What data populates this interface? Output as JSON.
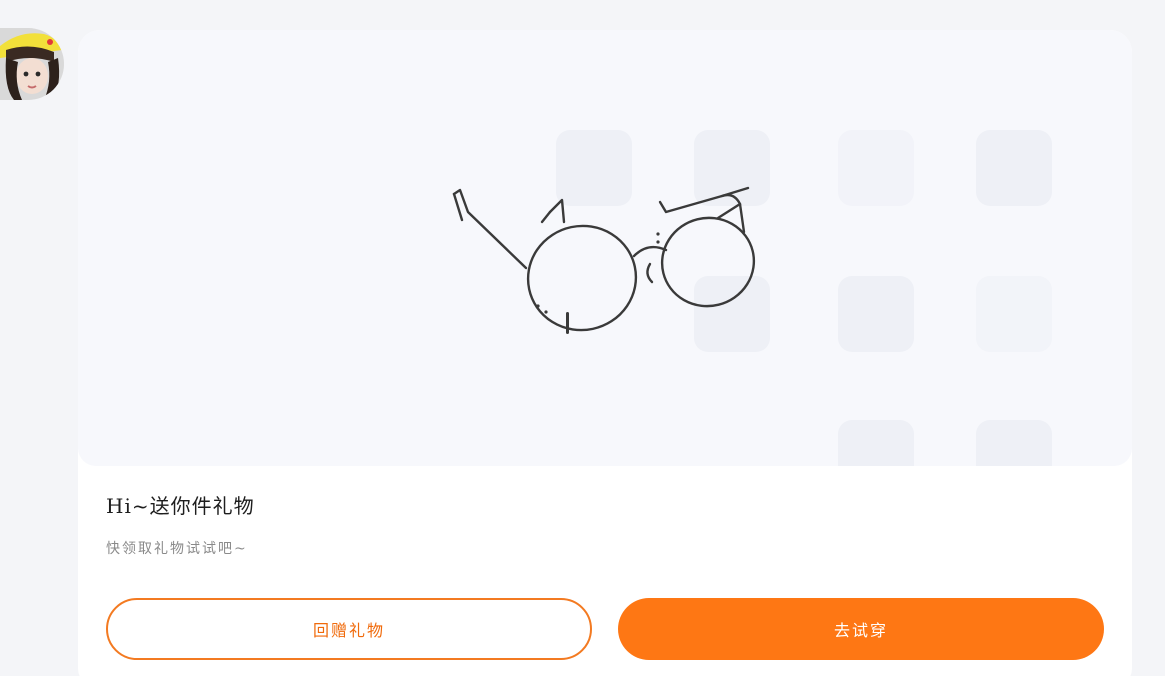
{
  "avatar": {
    "icon": "user-avatar"
  },
  "gift_card": {
    "image": {
      "icon": "cat-ear-glasses-icon"
    },
    "title": "Hi~送你件礼物",
    "subtitle": "快领取礼物试试吧~"
  },
  "actions": {
    "return_gift_label": "回赠礼物",
    "try_on_label": "去试穿"
  },
  "colors": {
    "accent": "#fe7714",
    "outline": "#f37a21",
    "background": "#f4f5f8"
  }
}
